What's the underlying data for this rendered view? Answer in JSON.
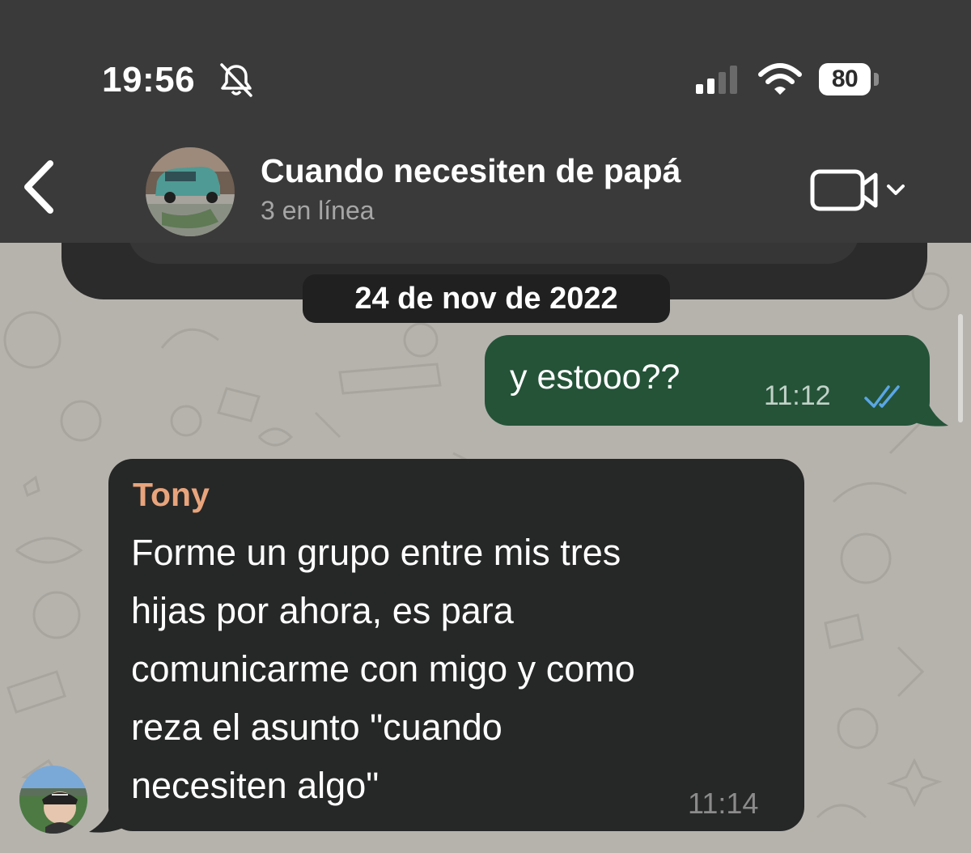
{
  "status_bar": {
    "time": "19:56",
    "battery": "80"
  },
  "header": {
    "title": "Cuando necesiten de papá",
    "subtitle": "3 en línea"
  },
  "date_separator": "24 de nov de 2022",
  "messages": [
    {
      "direction": "outgoing",
      "text": "y estooo??",
      "time": "11:12",
      "status": "read"
    },
    {
      "direction": "incoming",
      "sender": "Tony",
      "lines": [
        "Forme un grupo entre mis tres",
        "hijas por ahora, es para",
        "comunicarme con migo y como",
        "reza el asunto \"cuando",
        "necesiten algo\""
      ],
      "time": "11:14"
    }
  ],
  "colors": {
    "header_bg": "#3a3a3a",
    "outgoing_bubble": "#245338",
    "incoming_bubble": "#262727",
    "sender_name": "#e8a47c",
    "read_ticks": "#5aa6e6",
    "wallpaper": "#b6b3ad"
  },
  "icons": [
    "bell-muted-icon",
    "signal-icon",
    "wifi-icon",
    "battery-icon",
    "back-chevron-icon",
    "video-call-icon",
    "chevron-down-icon",
    "double-check-icon"
  ]
}
